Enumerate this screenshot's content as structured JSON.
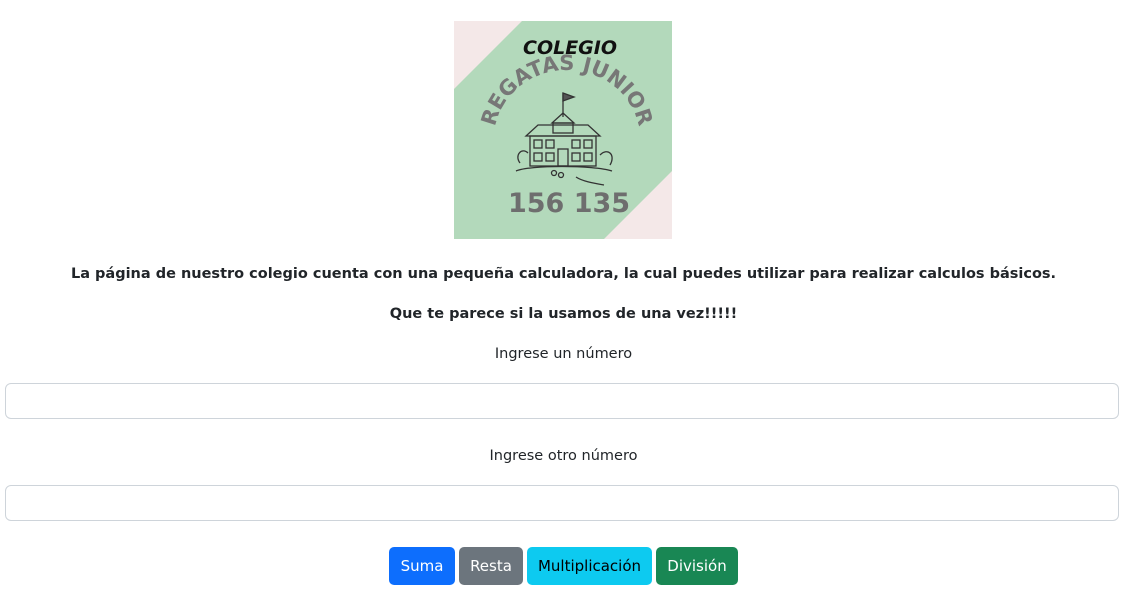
{
  "logo": {
    "top_text": "COLEGIO",
    "arc_text": "REGATAS JUNIOR",
    "number": "156 135",
    "colors": {
      "green": "#b3d9bb",
      "corner": "#f4e8e8",
      "ink": "#6e6e6e"
    }
  },
  "intro": {
    "line1": "La página de nuestro colegio cuenta con una pequeña calculadora, la cual puedes utilizar para realizar calculos básicos.",
    "line2": "Que te parece si la usamos de una vez!!!!!"
  },
  "form": {
    "first_label": "Ingrese un número",
    "first_value": "",
    "second_label": "Ingrese otro número",
    "second_value": ""
  },
  "buttons": {
    "suma": "Suma",
    "resta": "Resta",
    "multiplicacion": "Multiplicación",
    "division": "División"
  },
  "colors": {
    "primary": "#0d6efd",
    "secondary": "#6c757d",
    "info": "#0dcaf0",
    "success": "#198754"
  }
}
